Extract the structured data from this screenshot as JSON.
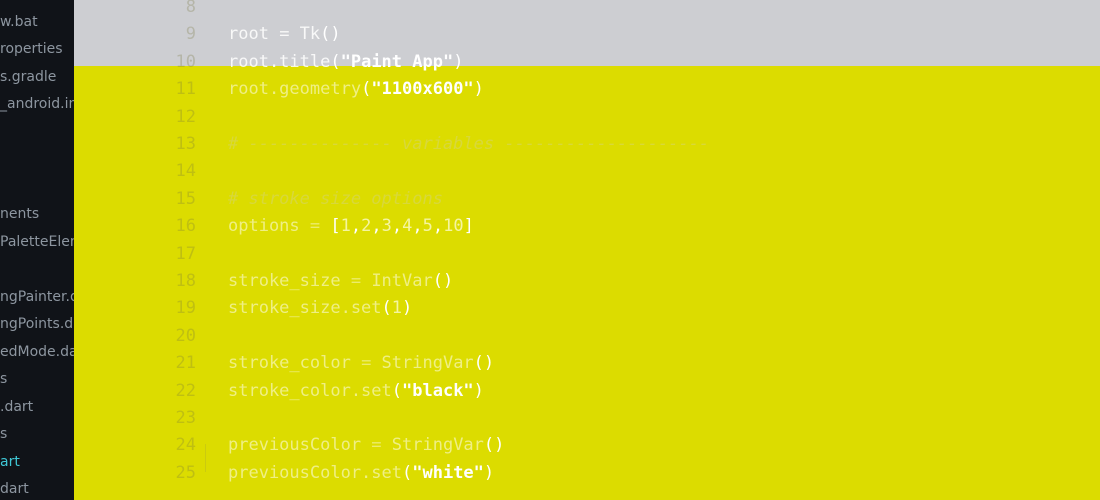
{
  "sidebar": {
    "items": [
      {
        "label": "w.bat",
        "active": false
      },
      {
        "label": "roperties",
        "active": false
      },
      {
        "label": "s.gradle",
        "active": false
      },
      {
        "label": "_android.iml",
        "active": false
      },
      {
        "label": "nents",
        "active": false
      },
      {
        "label": "PaletteElem.dart",
        "active": false
      },
      {
        "label": "ngPainter.dart",
        "active": false
      },
      {
        "label": "ngPoints.dart",
        "active": false
      },
      {
        "label": "edMode.dart",
        "active": false
      },
      {
        "label": "s",
        "active": false
      },
      {
        "label": ".dart",
        "active": false
      },
      {
        "label": "s",
        "active": false
      },
      {
        "label": "art",
        "active": true
      },
      {
        "label": "dart",
        "active": false
      }
    ]
  },
  "editor": {
    "line_numbers": [
      "8",
      "9",
      "10",
      "11",
      "12",
      "13",
      "14",
      "15",
      "16",
      "17",
      "18",
      "19",
      "20",
      "21",
      "22",
      "23",
      "24",
      "25"
    ],
    "lines": [
      [],
      [
        {
          "t": "id",
          "v": "root"
        },
        {
          "t": "op",
          "v": " = "
        },
        {
          "t": "id",
          "v": "Tk"
        },
        {
          "t": "punc",
          "v": "()"
        }
      ],
      [
        {
          "t": "id",
          "v": "root.title"
        },
        {
          "t": "punc",
          "v": "("
        },
        {
          "t": "str",
          "v": "\"Paint App\""
        },
        {
          "t": "punc",
          "v": ")"
        }
      ],
      [
        {
          "t": "id",
          "v": "root.geometry"
        },
        {
          "t": "punc",
          "v": "("
        },
        {
          "t": "str",
          "v": "\"1100x600\""
        },
        {
          "t": "punc",
          "v": ")"
        }
      ],
      [],
      [
        {
          "t": "com",
          "v": "# -------------- variables --------------------"
        }
      ],
      [],
      [
        {
          "t": "com",
          "v": "# stroke size options"
        }
      ],
      [
        {
          "t": "id",
          "v": "options"
        },
        {
          "t": "op",
          "v": " = "
        },
        {
          "t": "punc",
          "v": "["
        },
        {
          "t": "num",
          "v": "1"
        },
        {
          "t": "punc",
          "v": ","
        },
        {
          "t": "num",
          "v": "2"
        },
        {
          "t": "punc",
          "v": ","
        },
        {
          "t": "num",
          "v": "3"
        },
        {
          "t": "punc",
          "v": ","
        },
        {
          "t": "num",
          "v": "4"
        },
        {
          "t": "punc",
          "v": ","
        },
        {
          "t": "num",
          "v": "5"
        },
        {
          "t": "punc",
          "v": ","
        },
        {
          "t": "num",
          "v": "10"
        },
        {
          "t": "punc",
          "v": "]"
        }
      ],
      [],
      [
        {
          "t": "id",
          "v": "stroke_size"
        },
        {
          "t": "op",
          "v": " = "
        },
        {
          "t": "id",
          "v": "IntVar"
        },
        {
          "t": "punc",
          "v": "()"
        }
      ],
      [
        {
          "t": "id",
          "v": "stroke_size.set"
        },
        {
          "t": "punc",
          "v": "("
        },
        {
          "t": "num",
          "v": "1"
        },
        {
          "t": "punc",
          "v": ")"
        }
      ],
      [],
      [
        {
          "t": "id",
          "v": "stroke_color"
        },
        {
          "t": "op",
          "v": " = "
        },
        {
          "t": "id",
          "v": "StringVar"
        },
        {
          "t": "punc",
          "v": "()"
        }
      ],
      [
        {
          "t": "id",
          "v": "stroke_color.set"
        },
        {
          "t": "punc",
          "v": "("
        },
        {
          "t": "str",
          "v": "\"black\""
        },
        {
          "t": "punc",
          "v": ")"
        }
      ],
      [],
      [
        {
          "t": "id",
          "v": "previousColor"
        },
        {
          "t": "op",
          "v": " = "
        },
        {
          "t": "id",
          "v": "StringVar"
        },
        {
          "t": "punc",
          "v": "()"
        }
      ],
      [
        {
          "t": "id",
          "v": "previousColor.set"
        },
        {
          "t": "punc",
          "v": "("
        },
        {
          "t": "str",
          "v": "\"white\""
        },
        {
          "t": "punc",
          "v": ")"
        }
      ]
    ]
  },
  "colors": {
    "editor_background": "#dcdc00",
    "top_band": "#cdced2",
    "sidebar_background": "#101318",
    "sidebar_text": "#8d96a0",
    "sidebar_active_text": "#3fc8d6"
  }
}
